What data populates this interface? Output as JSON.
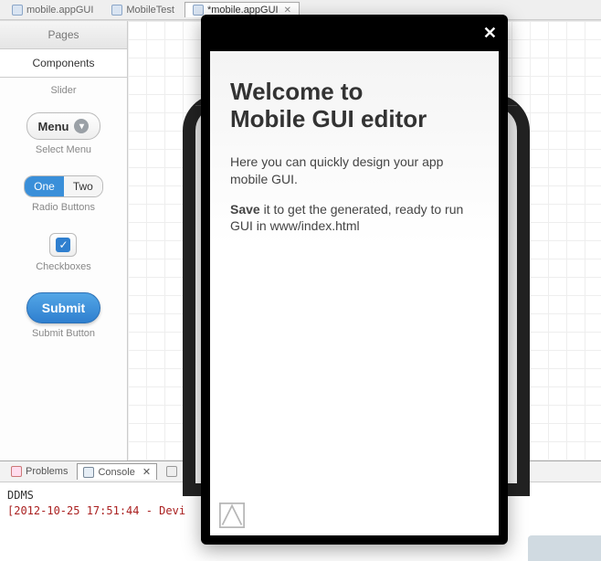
{
  "tabs": [
    {
      "label": "mobile.appGUI"
    },
    {
      "label": "MobileTest"
    },
    {
      "label": "*mobile.appGUI"
    }
  ],
  "sidebar": {
    "pages_label": "Pages",
    "components_label": "Components",
    "slider_label": "Slider",
    "menu_button": "Menu",
    "select_menu_label": "Select Menu",
    "radio_one": "One",
    "radio_two": "Two",
    "radio_label": "Radio Buttons",
    "checkbox_label": "Checkboxes",
    "submit_button": "Submit",
    "submit_label": "Submit Button"
  },
  "bottom": {
    "problems_tab": "Problems",
    "console_tab": "Console",
    "ddms_line": "DDMS",
    "log_line": "[2012-10-25 17:51:44 - Devi"
  },
  "modal": {
    "title_line1": "Welcome to",
    "title_line2": "Mobile GUI editor",
    "para1": "Here you can quickly design your app mobile GUI.",
    "save_word": "Save",
    "para2_rest": " it to get the generated, ready to run GUI in www/index.html"
  }
}
